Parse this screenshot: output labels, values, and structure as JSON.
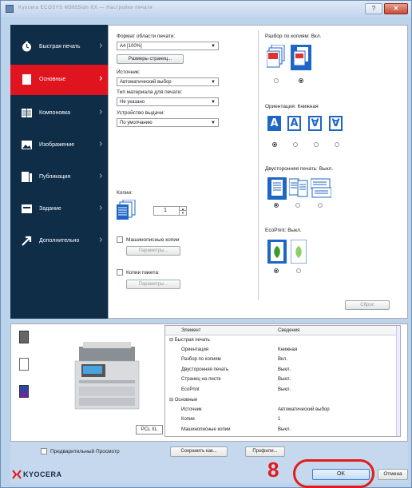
{
  "window": {
    "title": "Kyocera ECOSYS M3655idn KX — Настройки печати"
  },
  "titlebar": {
    "help": "?",
    "close": "✕"
  },
  "sidebar": {
    "items": [
      {
        "label": "Быстрая печать",
        "icon": "quick-print-icon"
      },
      {
        "label": "Основные",
        "icon": "basic-icon",
        "active": true
      },
      {
        "label": "Компоновка",
        "icon": "layout-icon"
      },
      {
        "label": "Изображение",
        "icon": "image-icon"
      },
      {
        "label": "Публикация",
        "icon": "publishing-icon"
      },
      {
        "label": "Задание",
        "icon": "job-icon"
      },
      {
        "label": "Дополнительно",
        "icon": "advanced-icon"
      }
    ]
  },
  "basic": {
    "paper_size_label": "Формат области печати:",
    "paper_size_value": "A4 [100%]",
    "page_sizes_button": "Размеры страниц...",
    "source_label": "Источник:",
    "source_value": "Автоматический выбор",
    "media_type_label": "Тип материала для печати:",
    "media_type_value": "Не указано",
    "output_label": "Устройство выдачи:",
    "output_value": "По умолчанию",
    "copies_label": "Копии:",
    "copies_value": "1",
    "mailbox_label": "Машинописные копии",
    "mailbox_params": "Параметры...",
    "copy_job_label": "Копии пакета:",
    "copy_job_params": "Параметры...",
    "collate_label": "Разбор по копиям:",
    "collate_value": "Вкл.",
    "orientation_label": "Ориентация:",
    "orientation_value": "Книжная",
    "duplex_label": "Двусторонняя печать:",
    "duplex_value": "Выкл.",
    "ecoprint_label": "EcoPrint:",
    "ecoprint_value": "Выкл.",
    "reset_button": "Сброс"
  },
  "preview": {
    "pcl_badge": "PCL XL"
  },
  "summary": {
    "col_element": "Элемент",
    "col_details": "Сведения",
    "rows": [
      {
        "k": "⊟ Быстрая печать",
        "v": "",
        "indent": 0
      },
      {
        "k": "Ориентация",
        "v": "Книжная",
        "indent": 1
      },
      {
        "k": "Разбор по копиям",
        "v": "Вкл.",
        "indent": 1
      },
      {
        "k": "Двусторонняя печать",
        "v": "Выкл.",
        "indent": 1
      },
      {
        "k": "Страниц на листе",
        "v": "Выкл.",
        "indent": 1
      },
      {
        "k": "EcoPrint",
        "v": "Выкл.",
        "indent": 1
      },
      {
        "k": "⊟ Основные",
        "v": "",
        "indent": 0
      },
      {
        "k": "Источник",
        "v": "Автоматический выбор",
        "indent": 1
      },
      {
        "k": "Копии",
        "v": "1",
        "indent": 1
      },
      {
        "k": "Машинописные копии",
        "v": "Выкл.",
        "indent": 1
      }
    ]
  },
  "footer": {
    "preview_label": "Предварительный Просмотр",
    "save_as": "Сохранить как...",
    "profiles": "Профили...",
    "ok": "OK",
    "cancel": "Отмена",
    "logo": "KYOCERA",
    "step": "8"
  },
  "colors": {
    "sidebar": "#0f2d47",
    "active": "#e0141e",
    "accent": "#1e66c6",
    "highlight": "#e11c1c"
  }
}
